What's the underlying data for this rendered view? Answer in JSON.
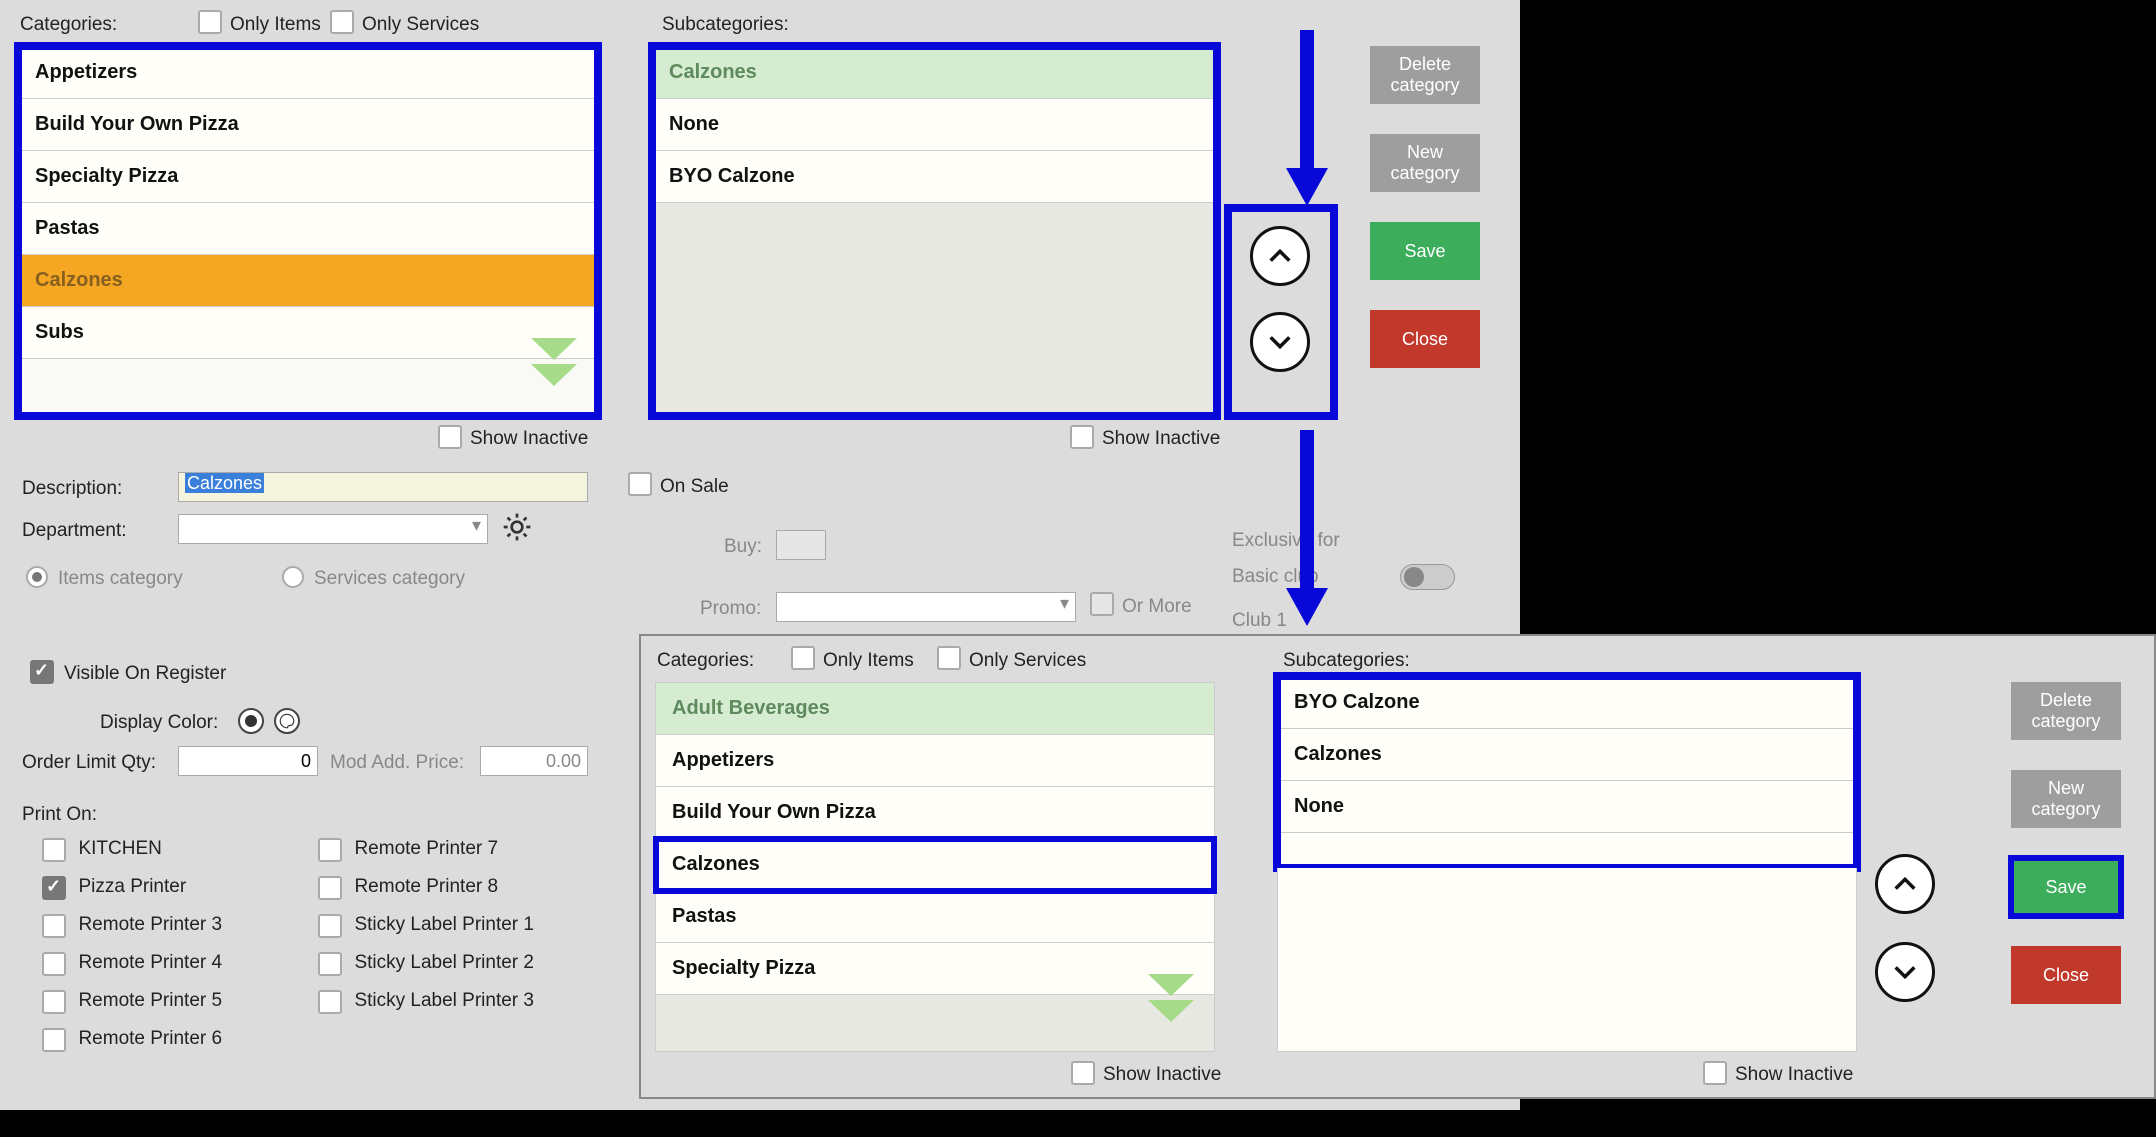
{
  "p1": {
    "categoriesLabel": "Categories:",
    "onlyItems": "Only Items",
    "onlyServices": "Only Services",
    "subcatsLabel": "Subcategories:",
    "catList": [
      "Appetizers",
      "Build Your Own Pizza",
      "Specialty Pizza",
      "Pastas",
      "Calzones",
      "Subs"
    ],
    "subList": [
      "Calzones",
      "None",
      "BYO Calzone"
    ],
    "showInactive": "Show Inactive",
    "btns": {
      "del": "Delete category",
      "new": "New category",
      "save": "Save",
      "close": "Close"
    },
    "desc": {
      "label": "Description:",
      "value": "Calzones"
    },
    "dept": "Department:",
    "itemsCat": "Items category",
    "servicesCat": "Services category",
    "onSale": "On Sale",
    "buy": "Buy:",
    "promo": "Promo:",
    "orMore": "Or More",
    "exclusive": "Exclusive for",
    "basicClub": "Basic club",
    "club1": "Club 1",
    "visibleReg": "Visible On Register",
    "displayColor": "Display Color:",
    "orderLimit": {
      "label": "Order Limit Qty:",
      "value": "0"
    },
    "modAdd": {
      "label": "Mod Add. Price:",
      "value": "0.00"
    },
    "printOn": "Print On:",
    "printers": {
      "col1": [
        "KITCHEN",
        "Pizza Printer",
        "Remote Printer 3",
        "Remote Printer 4",
        "Remote Printer 5",
        "Remote Printer 6"
      ],
      "col2": [
        "Remote Printer 7",
        "Remote Printer 8",
        "Sticky Label Printer 1",
        "Sticky Label Printer 2",
        "Sticky Label Printer 3"
      ]
    }
  },
  "p2": {
    "categoriesLabel": "Categories:",
    "onlyItems": "Only Items",
    "onlyServices": "Only Services",
    "subcatsLabel": "Subcategories:",
    "catList": [
      "Adult Beverages",
      "Appetizers",
      "Build Your Own Pizza",
      "Calzones",
      "Pastas",
      "Specialty Pizza"
    ],
    "subList": [
      "BYO Calzone",
      "Calzones",
      "None"
    ],
    "showInactive": "Show Inactive",
    "btns": {
      "del": "Delete category",
      "new": "New category",
      "save": "Save",
      "close": "Close"
    }
  }
}
